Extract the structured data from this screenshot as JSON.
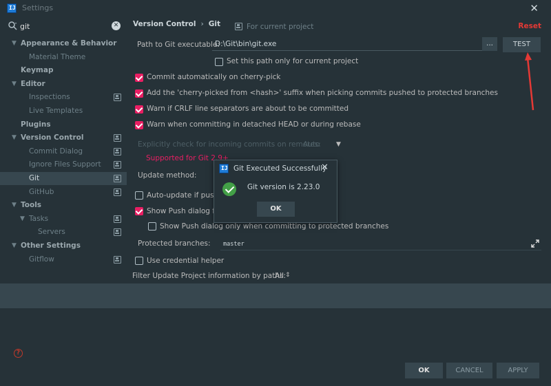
{
  "window": {
    "title": "Settings",
    "close": "✕",
    "logo": "IJ"
  },
  "search": {
    "value": "git",
    "clear": "✕"
  },
  "sidebar": {
    "items": [
      {
        "label": "Appearance & Behavior",
        "arrow": "▼"
      },
      {
        "label": "Material Theme"
      },
      {
        "label": "Keymap"
      },
      {
        "label": "Editor",
        "arrow": "▼"
      },
      {
        "label": "Inspections"
      },
      {
        "label": "Live Templates"
      },
      {
        "label": "Plugins"
      },
      {
        "label": "Version Control",
        "arrow": "▼"
      },
      {
        "label": "Commit Dialog"
      },
      {
        "label": "Ignore Files Support"
      },
      {
        "label": "Git"
      },
      {
        "label": "GitHub"
      },
      {
        "label": "Tools",
        "arrow": "▼"
      },
      {
        "label": "Tasks",
        "arrow": "▼"
      },
      {
        "label": "Servers"
      },
      {
        "label": "Other Settings",
        "arrow": "▼"
      },
      {
        "label": "Gitflow"
      }
    ]
  },
  "main": {
    "breadcrumb": {
      "parent": "Version Control",
      "separator": "›",
      "current": "Git"
    },
    "scope": "For current project",
    "reset": "Reset",
    "path_label": "Path to Git executable:",
    "path_value": "D:\\Git\\bin\\git.exe",
    "browse": "...",
    "test": "TEST",
    "path_for_project": "Set this path only for current project",
    "options": {
      "cherry_pick": "Commit automatically on cherry-pick",
      "cherry_suffix": "Add the 'cherry-picked from <hash>' suffix when picking commits pushed to protected branches",
      "crlf": "Warn if CRLF line separators are about to be committed",
      "detached": "Warn when committing in detached HEAD or during rebase"
    },
    "incoming_label": "Explicitly check for incoming commits on remotes:",
    "incoming_value": "Auto",
    "incoming_arrow": "▼",
    "supported": "Supported for Git 2.9+",
    "update_method": "Update method:",
    "auto_update": "Auto-update if push o",
    "show_push": "Show Push dialog for",
    "show_push_protected": "Show Push dialog only when committing to protected branches",
    "protected_label": "Protected branches:",
    "protected_value": "master",
    "credential": "Use credential helper",
    "filter_label": "Filter Update Project information by paths:",
    "filter_value": "All",
    "filter_arrow": "⇕"
  },
  "footer": {
    "help": "?",
    "ok": "OK",
    "cancel": "CANCEL",
    "apply": "APPLY"
  },
  "dialog": {
    "title": "Git Executed Successfully",
    "close": "✕",
    "message": "Git version is 2.23.0",
    "ok": "OK"
  }
}
